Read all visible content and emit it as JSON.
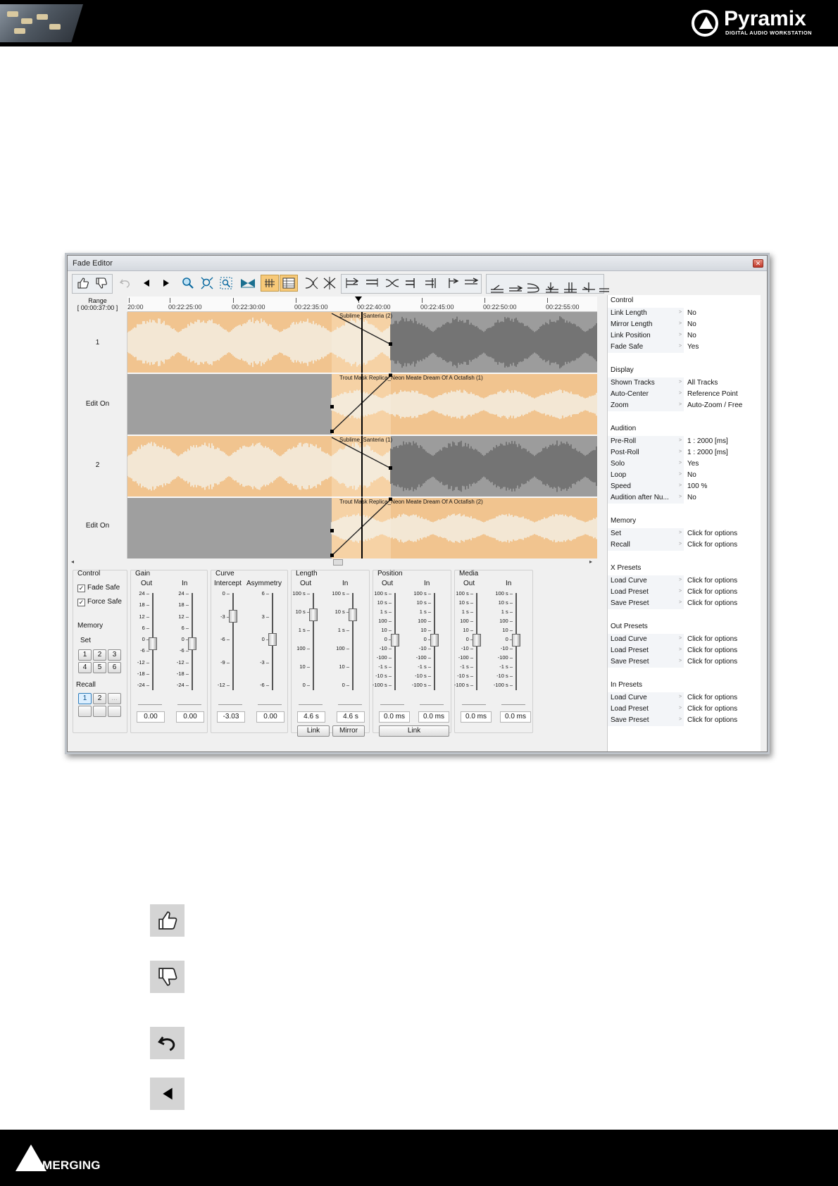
{
  "header": {
    "brand": "Pyramix",
    "tagline": "DIGITAL AUDIO WORKSTATION"
  },
  "footer": {
    "brand": "MERGING"
  },
  "window": {
    "title": "Fade Editor"
  },
  "timeline": {
    "range_label": "Range",
    "range_value": "[ 00:00:37:00 ]",
    "ticks": [
      "20:00",
      "00:22:25:00",
      "00:22:30:00",
      "00:22:35:00",
      "00:22:40:00",
      "00:22:45:00",
      "00:22:50:00",
      "00:22:55:00"
    ]
  },
  "tracks": [
    {
      "label": "1",
      "clip": "Sublime_Santeria (2)"
    },
    {
      "label": "Edit On",
      "clip": "Trout Mask Replica_Neon Meate Dream Of A Octafish (1)"
    },
    {
      "label": "2",
      "clip": "Sublime_Santeria (1)"
    },
    {
      "label": "Edit On",
      "clip": "Trout Mask Replica_Neon Meate Dream Of A Octafish (2)"
    }
  ],
  "controls": {
    "control": {
      "title": "Control",
      "fade_safe": "Fade Safe",
      "force_safe": "Force Safe",
      "memory": "Memory",
      "set": "Set",
      "recall": "Recall",
      "set_buttons": [
        "1",
        "2",
        "3",
        "4",
        "5",
        "6"
      ],
      "recall_buttons": [
        "1",
        "2",
        "..."
      ]
    },
    "gain": {
      "title": "Gain",
      "out": "Out",
      "in": "In",
      "scale": [
        "24",
        "18",
        "12",
        "6",
        "0",
        "-6",
        "-12",
        "-18",
        "-24"
      ],
      "out_value": "0.00",
      "in_value": "0.00"
    },
    "curve": {
      "title": "Curve",
      "intercept": "Intercept",
      "asymmetry": "Asymmetry",
      "intercept_scale": [
        "0",
        "-3",
        "-6",
        "-9",
        "-12"
      ],
      "asymmetry_scale": [
        "6",
        "3",
        "0",
        "-3",
        "-6"
      ],
      "intercept_value": "-3.03",
      "asymmetry_value": "0.00"
    },
    "length": {
      "title": "Length",
      "out": "Out",
      "in": "In",
      "scale": [
        "100 s",
        "10 s",
        "1 s",
        "100",
        "10",
        "0"
      ],
      "out_value": "4.6 s",
      "in_value": "4.6 s",
      "link": "Link",
      "mirror": "Mirror"
    },
    "position": {
      "title": "Position",
      "out": "Out",
      "in": "In",
      "scale": [
        "100 s",
        "10 s",
        "1 s",
        "100",
        "10",
        "0",
        "-10",
        "-100",
        "-1 s",
        "-10 s",
        "-100 s"
      ],
      "out_value": "0.0 ms",
      "in_value": "0.0 ms",
      "link": "Link"
    },
    "media": {
      "title": "Media",
      "out": "Out",
      "in": "In",
      "scale": [
        "100 s",
        "10 s",
        "1 s",
        "100",
        "10",
        "0",
        "-10",
        "-100",
        "-1 s",
        "-10 s",
        "-100 s"
      ],
      "out_value": "0.0 ms",
      "in_value": "0.0 ms"
    }
  },
  "properties": [
    {
      "section": "Control",
      "rows": [
        {
          "key": "Link Length",
          "value": "No"
        },
        {
          "key": "Mirror Length",
          "value": "No"
        },
        {
          "key": "Link Position",
          "value": "No"
        },
        {
          "key": "Fade Safe",
          "value": "Yes"
        }
      ]
    },
    {
      "section": "Display",
      "rows": [
        {
          "key": "Shown Tracks",
          "value": "All Tracks"
        },
        {
          "key": "Auto-Center",
          "value": "Reference Point"
        },
        {
          "key": "Zoom",
          "value": "Auto-Zoom / Free"
        }
      ]
    },
    {
      "section": "Audition",
      "rows": [
        {
          "key": "Pre-Roll",
          "value": "1 : 2000 [ms]"
        },
        {
          "key": "Post-Roll",
          "value": "1 : 2000 [ms]"
        },
        {
          "key": "Solo",
          "value": "Yes"
        },
        {
          "key": "Loop",
          "value": "No"
        },
        {
          "key": "Speed",
          "value": "100 %"
        },
        {
          "key": "Audition after Nu...",
          "value": "No"
        }
      ]
    },
    {
      "section": "Memory",
      "rows": [
        {
          "key": "Set",
          "value": "Click for options"
        },
        {
          "key": "Recall",
          "value": "Click for options"
        }
      ]
    },
    {
      "section": "X Presets",
      "rows": [
        {
          "key": "Load Curve",
          "value": "Click for options"
        },
        {
          "key": "Load Preset",
          "value": "Click for options"
        },
        {
          "key": "Save Preset",
          "value": "Click for options"
        }
      ]
    },
    {
      "section": "Out Presets",
      "rows": [
        {
          "key": "Load Curve",
          "value": "Click for options"
        },
        {
          "key": "Load Preset",
          "value": "Click for options"
        },
        {
          "key": "Save Preset",
          "value": "Click for options"
        }
      ]
    },
    {
      "section": "In Presets",
      "rows": [
        {
          "key": "Load Curve",
          "value": "Click for options"
        },
        {
          "key": "Load Preset",
          "value": "Click for options"
        },
        {
          "key": "Save Preset",
          "value": "Click for options"
        }
      ]
    }
  ],
  "colors": {
    "fade_region": "#f1c48f",
    "waveform_light": "#f4f0e6",
    "waveform_dark": "#6b6b6b",
    "grey_region": "#9f9f9f",
    "toolbar_selected": "#f7c978"
  },
  "toolbar_icons": [
    "thumbs-up-icon",
    "thumbs-down-icon",
    "undo-icon",
    "previous-icon",
    "next-icon",
    "zoom-icon",
    "zoom-fit-icon",
    "zoom-region-icon",
    "bowtie-icon",
    "grid-icon",
    "table-icon",
    "fade-shape-icons"
  ],
  "legend_icons": [
    "thumbs-up-icon",
    "thumbs-down-icon",
    "undo-icon",
    "previous-icon"
  ]
}
